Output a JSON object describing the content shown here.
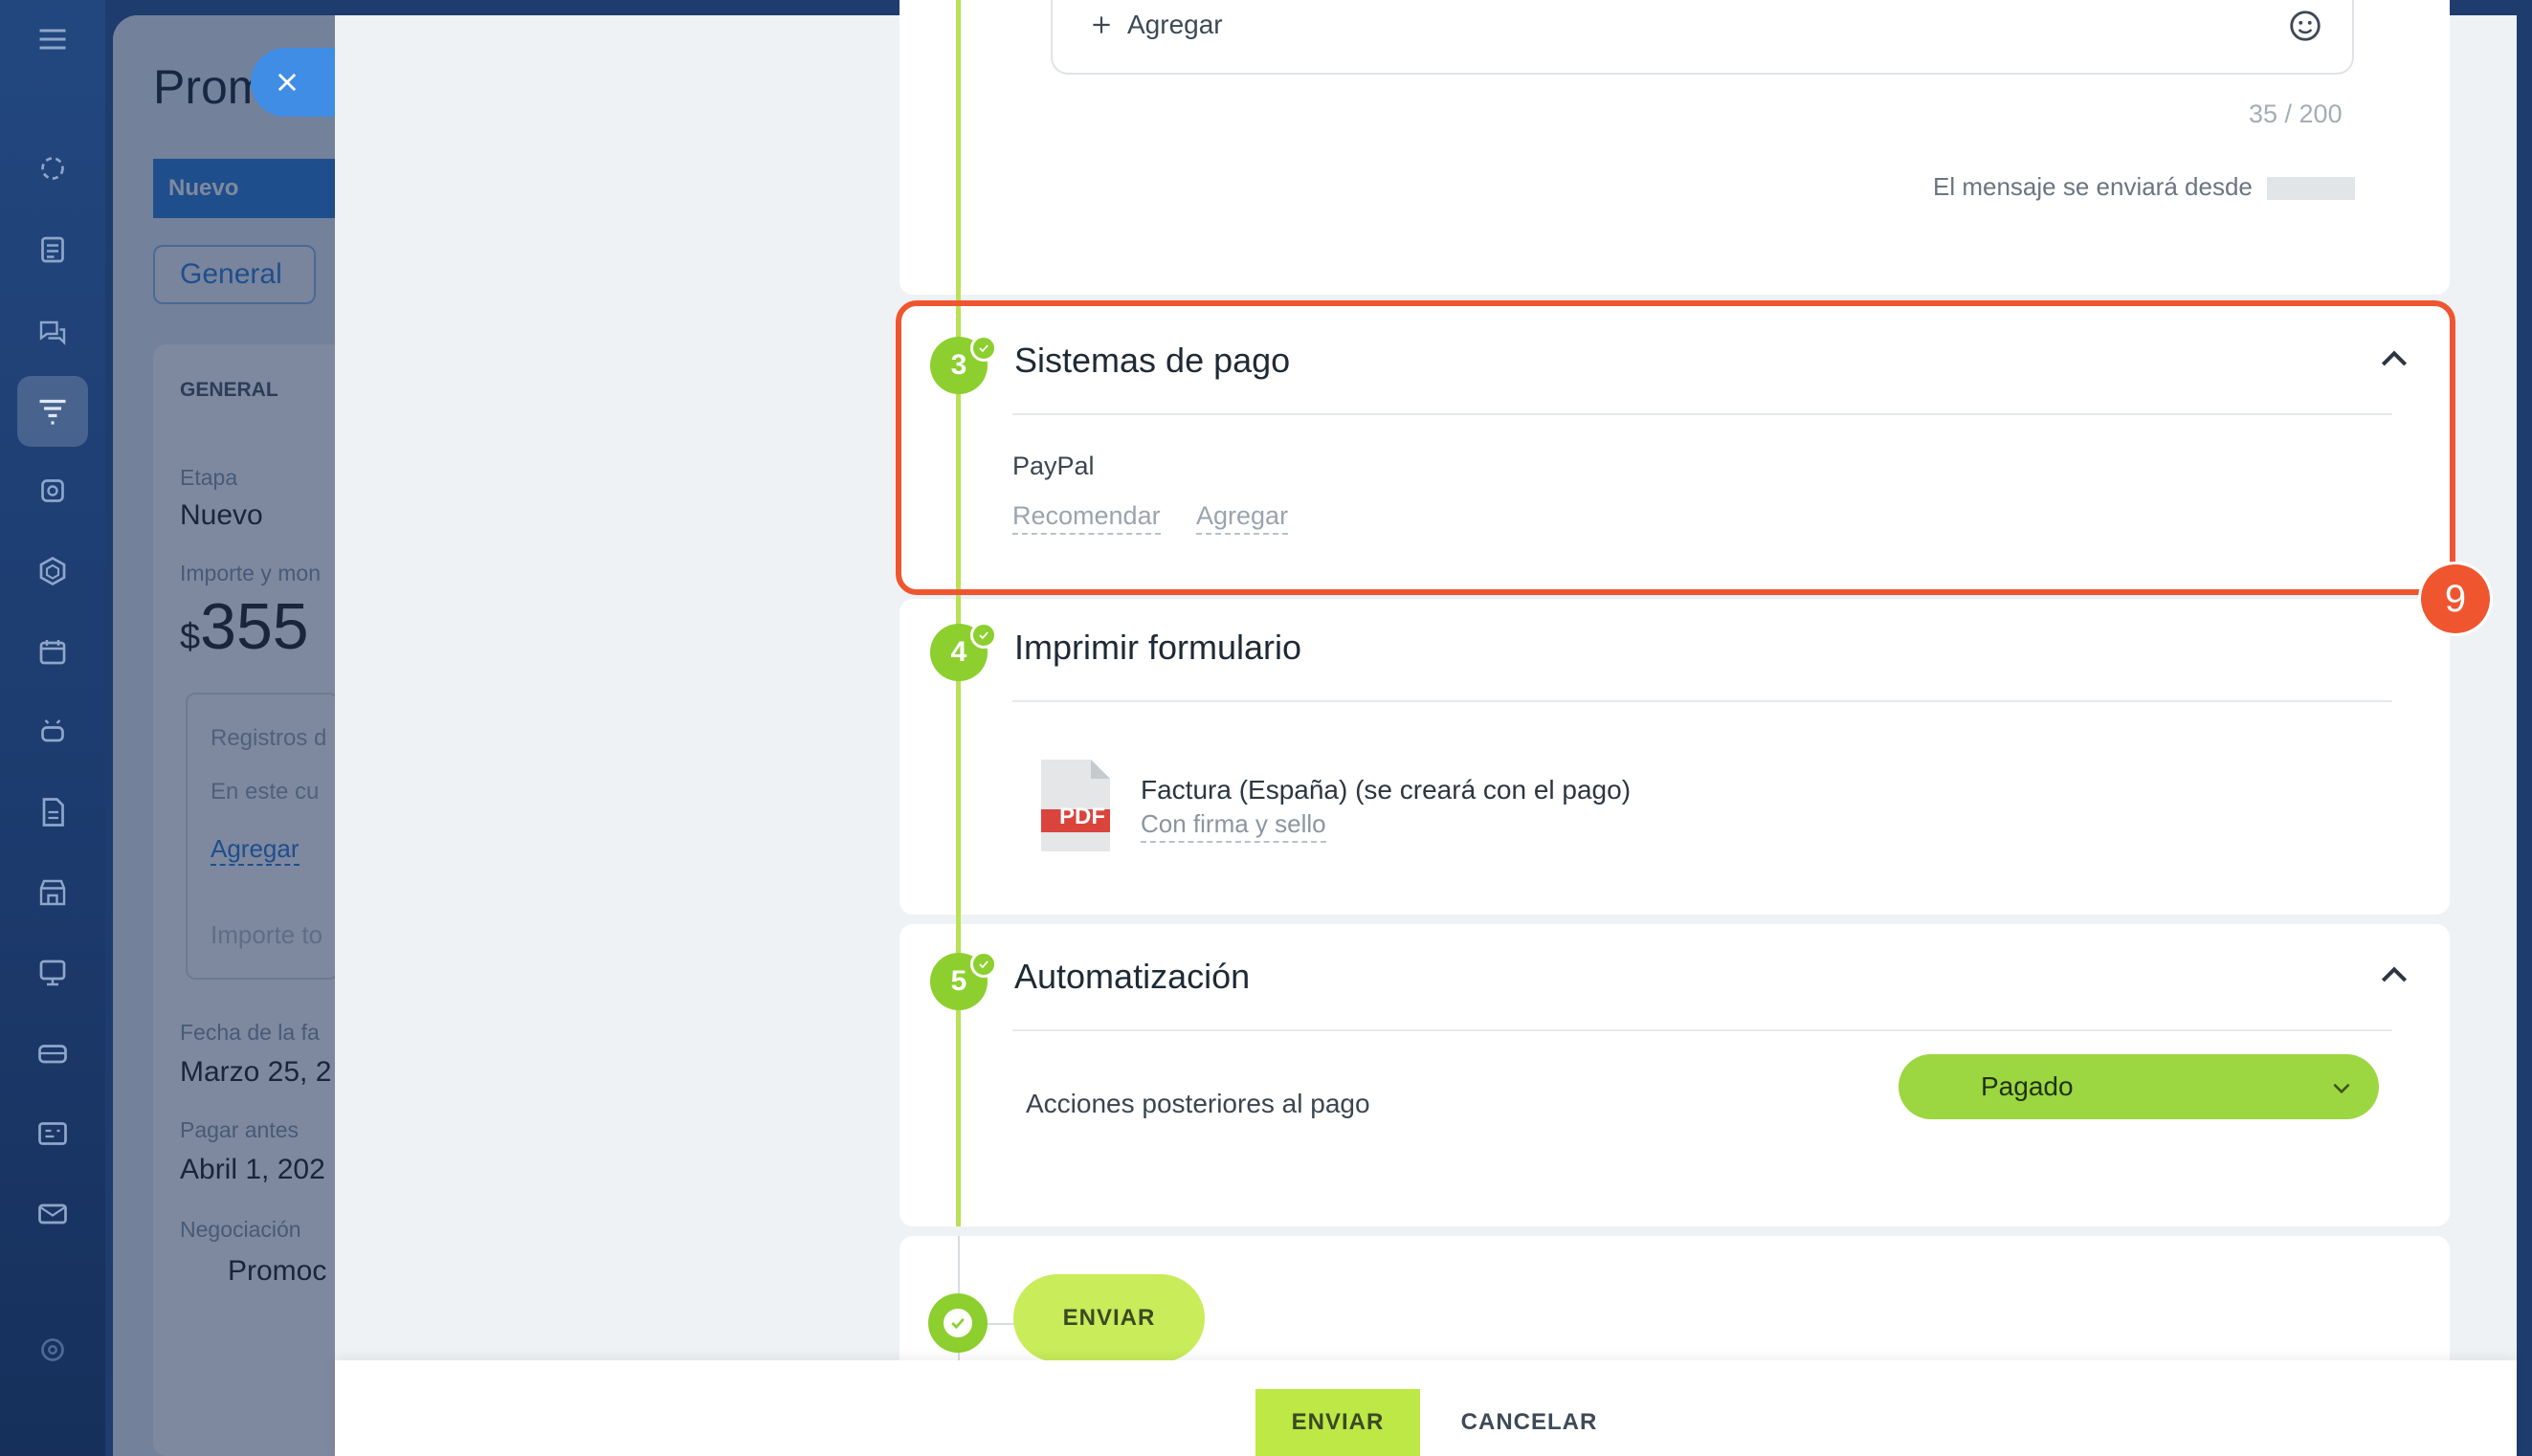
{
  "background": {
    "title": "Prom",
    "stage_button": "Nuevo",
    "tab_general": "General",
    "section_general": "GENERAL",
    "stage_label": "Etapa",
    "stage_value": "Nuevo",
    "amount_label": "Importe y mon",
    "amount_currency": "$",
    "amount_value": "355",
    "records_label": "Registros d",
    "records_text": "En este cu",
    "records_add": "Agregar",
    "importe_total": "Importe to",
    "invoice_date_label": "Fecha de la fa",
    "invoice_date_value": "Marzo 25, 2",
    "pay_before_label": "Pagar antes",
    "pay_before_value": "Abril 1, 202",
    "deal_label": "Negociación",
    "deal_value": "Promoc"
  },
  "message": {
    "add_label": "Agregar",
    "counter": "35 / 200",
    "sender_text": "El mensaje se enviará desde"
  },
  "steps": [
    {
      "num": "3",
      "title": "Sistemas de pago"
    },
    {
      "num": "4",
      "title": "Imprimir formulario"
    },
    {
      "num": "5",
      "title": "Automatización"
    }
  ],
  "payment": {
    "system": "PayPal",
    "recommend": "Recomendar",
    "add": "Agregar"
  },
  "print_form": {
    "pdf_label": "PDF",
    "doc_title": "Factura (España) (se creará con el pago)",
    "doc_option": "Con firma y sello"
  },
  "automation": {
    "label": "Acciones posteriores al pago",
    "select_value": "Pagado"
  },
  "send_step": {
    "button": "ENVIAR"
  },
  "footer": {
    "send": "ENVIAR",
    "cancel": "CANCELAR"
  },
  "annotation": {
    "badge": "9"
  },
  "colors": {
    "accent_green": "#8ccf2e",
    "button_green": "#bde845",
    "highlight_red": "#ef5630",
    "rail_blue": "#22477f",
    "link_blue": "#2e7cd6"
  }
}
